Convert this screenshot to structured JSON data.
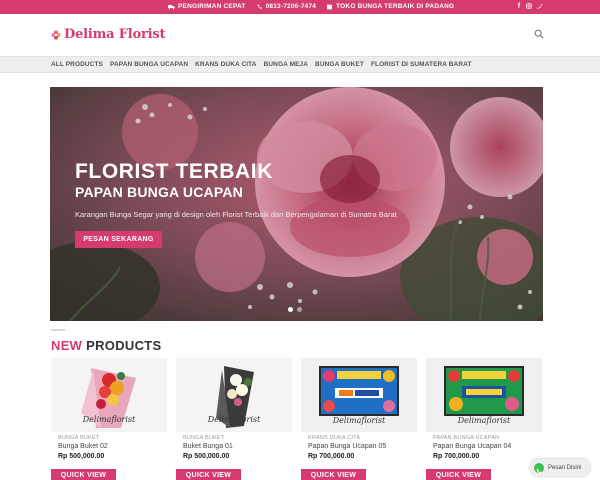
{
  "topbar": {
    "shipping": "PENGIRIMAN CEPAT",
    "phone": "0813-7206-7474",
    "store": "TOKO BUNGA TERBAIK DI PADANG",
    "social": [
      "facebook-icon",
      "instagram-icon",
      "twitter-icon"
    ]
  },
  "header": {
    "logo_text": "Delima Florist"
  },
  "nav": {
    "items": [
      "ALL PRODUCTS",
      "PAPAN BUNGA UCAPAN",
      "KRANS DUKA CITA",
      "BUNGA MEJA",
      "BUNGA BUKET",
      "FLORIST DI SUMATERA BARAT"
    ]
  },
  "hero": {
    "title": "FLORIST TERBAIK",
    "subtitle": "PAPAN BUNGA UCAPAN",
    "description": "Karangan Bunga Segar yang di design oleh Florist Terbaik dan Berpengalaman di Sumatra Barat",
    "cta": "PESAN SEKARANG",
    "slides": 2,
    "active_slide": 1
  },
  "new_products": {
    "title_accent": "NEW",
    "title_rest": " PRODUCTS",
    "quick_view": "QUICK VIEW",
    "items": [
      {
        "category": "BUNGA BUKET",
        "name": "Bunga Buket 02",
        "price": "Rp 500,000.00"
      },
      {
        "category": "BUNGA BUKET",
        "name": "Buket Bunga 01",
        "price": "Rp 500,000.00"
      },
      {
        "category": "KRANS DUKA CITA",
        "name": "Papan Bunga Ucapan 05",
        "price": "Rp 700,000.00"
      },
      {
        "category": "PAPAN BUNGA UCAPAN",
        "name": "Papan Bunga Ucapan 04",
        "price": "Rp 700,000.00"
      }
    ]
  },
  "whatsapp": {
    "label": "Pesan Disini"
  },
  "colors": {
    "brand": "#d63b6e",
    "whatsapp": "#3fbf4f"
  }
}
